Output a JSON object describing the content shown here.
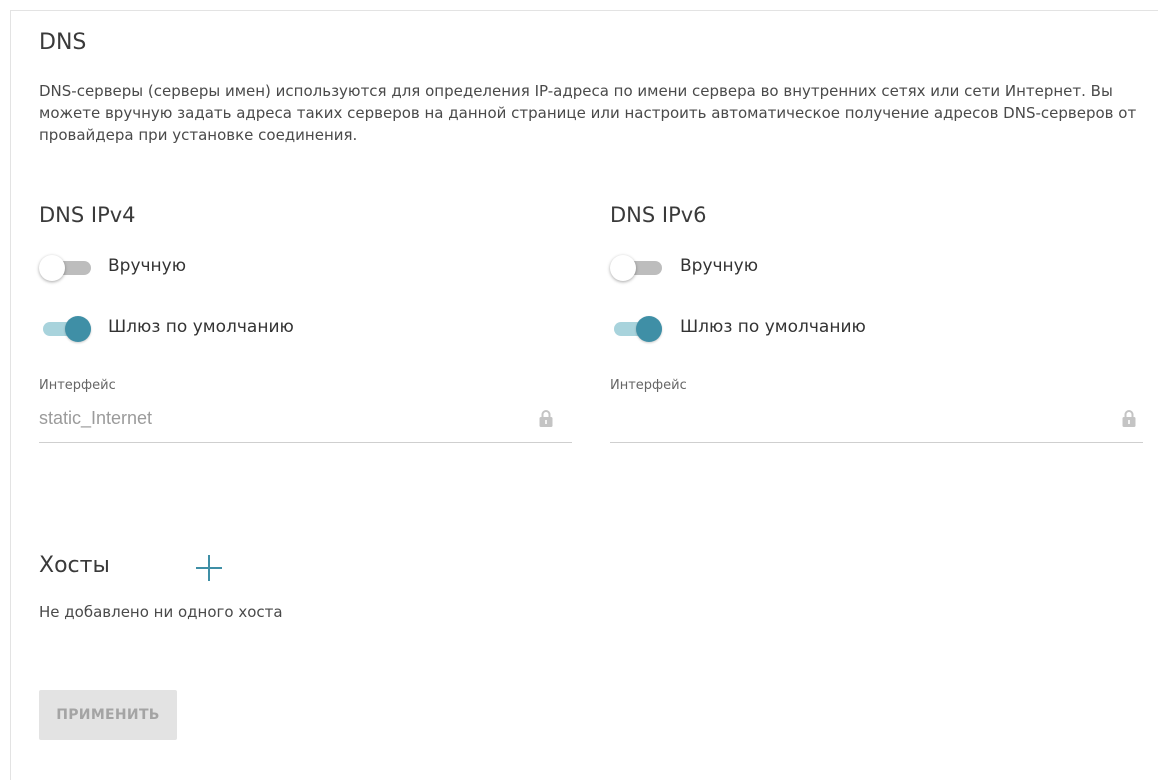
{
  "page": {
    "title": "DNS",
    "description": "DNS-серверы (серверы имен) используются для определения IP-адреса по имени сервера во внутренних сетях или сети Интернет. Вы можете вручную задать адреса таких серверов на данной странице или настроить автоматическое получение адресов DNS-серверов от провайдера при установке соединения."
  },
  "ipv4": {
    "heading": "DNS IPv4",
    "manual_label": "Вручную",
    "manual_on": false,
    "gateway_label": "Шлюз по умолчанию",
    "gateway_on": true,
    "interface_label": "Интерфейс",
    "interface_value": "static_Internet"
  },
  "ipv6": {
    "heading": "DNS IPv6",
    "manual_label": "Вручную",
    "manual_on": false,
    "gateway_label": "Шлюз по умолчанию",
    "gateway_on": true,
    "interface_label": "Интерфейс",
    "interface_value": ""
  },
  "hosts": {
    "title": "Хосты",
    "empty_text": "Не добавлено ни одного хоста",
    "add_icon": "plus-icon"
  },
  "actions": {
    "apply_label": "ПРИМЕНИТЬ"
  },
  "colors": {
    "accent": "#3f8fa6",
    "accent_light": "#a8d3dc",
    "toggle_off": "#bdbdbd",
    "disabled_button_bg": "#e3e3e3",
    "disabled_button_text": "#a4a4a4"
  }
}
